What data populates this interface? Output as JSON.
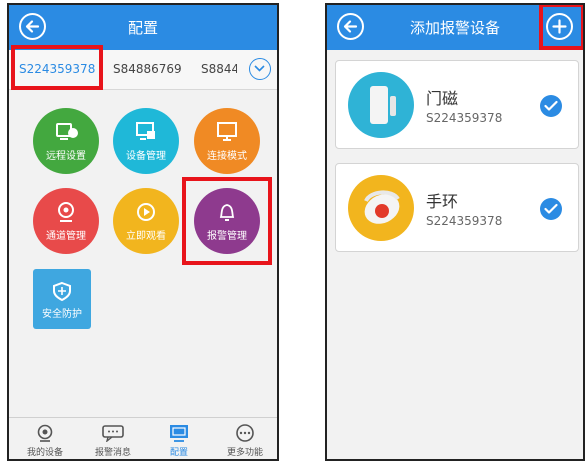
{
  "config_screen": {
    "title": "配置",
    "device_tabs": [
      "S224359378",
      "S84886769",
      "S8844"
    ],
    "tiles": [
      {
        "label": "远程设置",
        "icon": "remote-settings-icon",
        "color": "#43a83f"
      },
      {
        "label": "设备管理",
        "icon": "device-management-icon",
        "color": "#1fb8d8"
      },
      {
        "label": "连接模式",
        "icon": "connection-mode-icon",
        "color": "#f08a24"
      },
      {
        "label": "通道管理",
        "icon": "channel-management-icon",
        "color": "#e84a4a"
      },
      {
        "label": "立即观看",
        "icon": "watch-now-icon",
        "color": "#f2b51e"
      },
      {
        "label": "报警管理",
        "icon": "alarm-management-icon",
        "color": "#8e3a8e"
      },
      {
        "label": "安全防护",
        "icon": "security-shield-icon",
        "color": "#3fa7e0"
      }
    ],
    "bottom_nav": [
      {
        "label": "我的设备",
        "icon": "camera-icon"
      },
      {
        "label": "报警消息",
        "icon": "message-icon"
      },
      {
        "label": "配置",
        "icon": "config-icon",
        "active": true
      },
      {
        "label": "更多功能",
        "icon": "more-icon"
      }
    ]
  },
  "alarm_screen": {
    "title": "添加报警设备",
    "devices": [
      {
        "name": "门磁",
        "serial": "S224359378",
        "checked": true,
        "thumb_color": "#2fb3d6"
      },
      {
        "name": "手环",
        "serial": "S224359378",
        "checked": true,
        "thumb_color": "#f2b51e"
      }
    ]
  },
  "colors": {
    "accent": "#2b8be3",
    "highlight": "#e8141b"
  }
}
